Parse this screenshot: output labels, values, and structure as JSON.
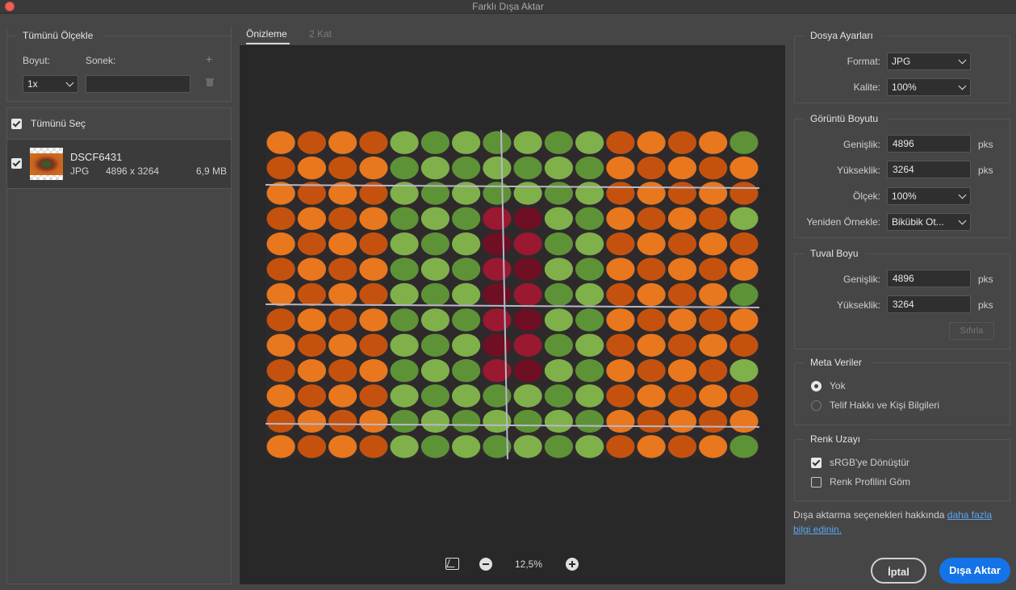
{
  "window": {
    "title": "Farklı Dışa Aktar"
  },
  "scale_all": {
    "title": "Tümünü Ölçekle",
    "size_label": "Boyut:",
    "suffix_label": "Sonek:",
    "size_value": "1x",
    "suffix_value": ""
  },
  "file_list": {
    "select_all_label": "Tümünü Seç",
    "files": [
      {
        "name": "DSCF6431",
        "format": "JPG",
        "dimensions": "4896 x 3264",
        "size": "6,9 MB",
        "checked": true
      }
    ]
  },
  "tabs": [
    {
      "label": "Önizleme",
      "active": true
    },
    {
      "label": "2 Kat",
      "active": false
    }
  ],
  "zoom": {
    "value": "12,5%"
  },
  "file_settings": {
    "title": "Dosya Ayarları",
    "format_label": "Format:",
    "format_value": "JPG",
    "quality_label": "Kalite:",
    "quality_value": "100%"
  },
  "image_size": {
    "title": "Görüntü Boyutu",
    "width_label": "Genişlik:",
    "width_value": "4896",
    "height_label": "Yükseklik:",
    "height_value": "3264",
    "scale_label": "Ölçek:",
    "scale_value": "100%",
    "resample_label": "Yeniden Örnekle:",
    "resample_value": "Bikübik Ot...",
    "unit": "pks"
  },
  "canvas_size": {
    "title": "Tuval Boyu",
    "width_label": "Genişlik:",
    "width_value": "4896",
    "height_label": "Yükseklik:",
    "height_value": "3264",
    "unit": "pks",
    "reset_label": "Sıfırla"
  },
  "metadata": {
    "title": "Meta Veriler",
    "options": [
      {
        "label": "Yok",
        "selected": true
      },
      {
        "label": "Telif Hakkı ve Kişi Bilgileri",
        "selected": false
      }
    ]
  },
  "color_space": {
    "title": "Renk Uzayı",
    "options": [
      {
        "label": "sRGB'ye Dönüştür",
        "checked": true
      },
      {
        "label": "Renk Profilini Göm",
        "checked": false
      }
    ]
  },
  "info": {
    "text": "Dışa aktarma seçenekleri hakkında ",
    "link": "daha fazla bilgi edinin."
  },
  "buttons": {
    "cancel": "İptal",
    "export": "Dışa Aktar"
  },
  "colors": {
    "accent": "#1473e6",
    "link": "#5aa7ee",
    "panel": "#464646",
    "canvas": "#282828"
  }
}
